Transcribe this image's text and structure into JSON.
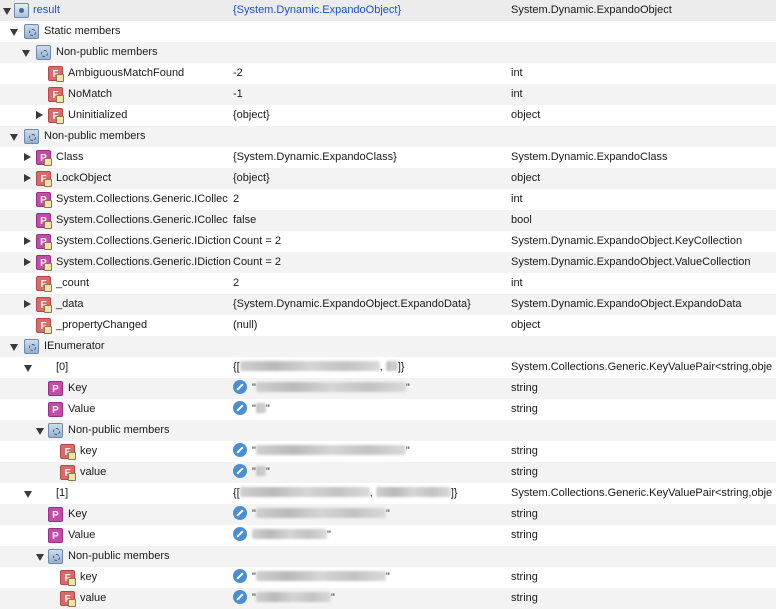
{
  "colors": {
    "row_alt": "#f3f3f3",
    "property_icon": "#c04da8",
    "field_icon": "#d86a6a",
    "edit_icon": "#4a8fd4",
    "selection_link": "#1f4fd0"
  },
  "rows": [
    {
      "name": "result",
      "value": "{System.Dynamic.ExpandoObject}",
      "type": "System.Dynamic.ExpandoObject",
      "icon": "variable-icon",
      "expander": "open",
      "link": true
    },
    {
      "name": "Static members",
      "value": "",
      "type": "",
      "icon": "group-icon",
      "expander": "open"
    },
    {
      "name": "Non-public members",
      "value": "",
      "type": "",
      "icon": "group-icon",
      "expander": "open"
    },
    {
      "name": "AmbiguousMatchFound",
      "value": "-2",
      "type": "int",
      "icon": "field-lock-icon",
      "expander": "none"
    },
    {
      "name": "NoMatch",
      "value": "-1",
      "type": "int",
      "icon": "field-lock-icon",
      "expander": "none"
    },
    {
      "name": "Uninitialized",
      "value": "{object}",
      "type": "object",
      "icon": "field-lock-icon",
      "expander": "closed"
    },
    {
      "name": "Non-public members",
      "value": "",
      "type": "",
      "icon": "group-icon",
      "expander": "open"
    },
    {
      "name": "Class",
      "value": "{System.Dynamic.ExpandoClass}",
      "type": "System.Dynamic.ExpandoClass",
      "icon": "property-lock-icon",
      "expander": "closed"
    },
    {
      "name": "LockObject",
      "value": "{object}",
      "type": "object",
      "icon": "field-lock-icon",
      "expander": "closed"
    },
    {
      "name": "System.Collections.Generic.ICollec",
      "value": "2",
      "type": "int",
      "icon": "property-lock-icon",
      "expander": "none"
    },
    {
      "name": "System.Collections.Generic.ICollec",
      "value": "false",
      "type": "bool",
      "icon": "property-lock-icon",
      "expander": "none"
    },
    {
      "name": "System.Collections.Generic.IDiction",
      "value": "Count = 2",
      "type": "System.Dynamic.ExpandoObject.KeyCollection",
      "icon": "property-lock-icon",
      "expander": "closed"
    },
    {
      "name": "System.Collections.Generic.IDiction",
      "value": "Count = 2",
      "type": "System.Dynamic.ExpandoObject.ValueCollection",
      "icon": "property-lock-icon",
      "expander": "closed"
    },
    {
      "name": "_count",
      "value": "2",
      "type": "int",
      "icon": "field-lock-icon",
      "expander": "none"
    },
    {
      "name": "_data",
      "value": "{System.Dynamic.ExpandoObject.ExpandoData}",
      "type": "System.Dynamic.ExpandoObject.ExpandoData",
      "icon": "field-lock-icon",
      "expander": "closed"
    },
    {
      "name": "_propertyChanged",
      "value": "(null)",
      "type": "object",
      "icon": "field-lock-icon",
      "expander": "none"
    },
    {
      "name": "IEnumerator",
      "value": "",
      "type": "",
      "icon": "group-icon",
      "expander": "open"
    },
    {
      "name": "[0]",
      "value": "{[",
      "type": "System.Collections.Generic.KeyValuePair<string,obje",
      "icon": "none",
      "expander": "open"
    },
    {
      "name": "Key",
      "value": "\"",
      "type": "string",
      "icon": "property-icon",
      "expander": "none",
      "edit": true
    },
    {
      "name": "Value",
      "value": "\"",
      "type": "string",
      "icon": "property-icon",
      "expander": "none",
      "edit": true
    },
    {
      "name": "Non-public members",
      "value": "",
      "type": "",
      "icon": "group-icon",
      "expander": "open"
    },
    {
      "name": "key",
      "value": "\"",
      "type": "string",
      "icon": "field-lock-icon",
      "expander": "none",
      "edit": true
    },
    {
      "name": "value",
      "value": "\"",
      "type": "string",
      "icon": "field-lock-icon",
      "expander": "none",
      "edit": true
    },
    {
      "name": "[1]",
      "value": "{[",
      "type": "System.Collections.Generic.KeyValuePair<string,obje",
      "icon": "none",
      "expander": "open"
    },
    {
      "name": "Key",
      "value": "\"",
      "type": "string",
      "icon": "property-icon",
      "expander": "none",
      "edit": true
    },
    {
      "name": "Value",
      "value": "",
      "type": "string",
      "icon": "property-icon",
      "expander": "none",
      "edit": true
    },
    {
      "name": "Non-public members",
      "value": "",
      "type": "",
      "icon": "group-icon",
      "expander": "open"
    },
    {
      "name": "key",
      "value": "\"",
      "type": "string",
      "icon": "field-lock-icon",
      "expander": "none",
      "edit": true
    },
    {
      "name": "value",
      "value": "\"",
      "type": "string",
      "icon": "field-lock-icon",
      "expander": "none",
      "edit": true
    }
  ]
}
